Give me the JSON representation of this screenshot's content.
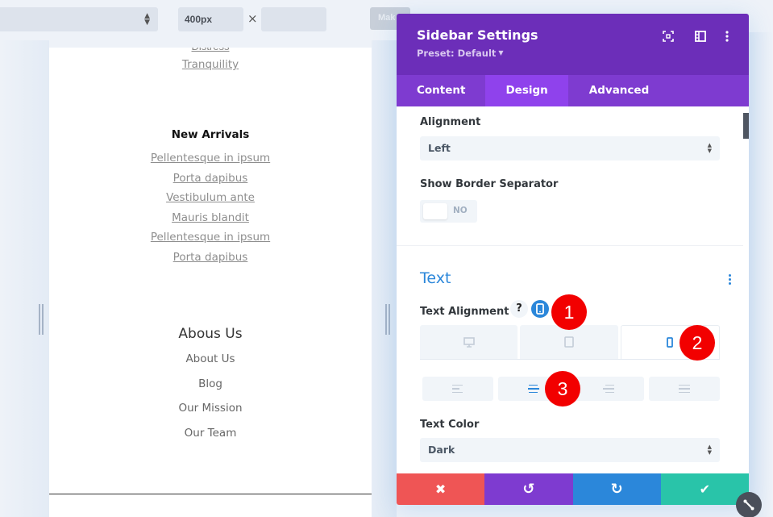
{
  "toolbar": {
    "device_select_value": "",
    "width_value": "400px",
    "times_symbol": "×",
    "height_value": "",
    "make_button_label": "Mak"
  },
  "preview": {
    "cut_link": "Distress",
    "tranquility_link": "Tranquility",
    "new_arrivals": {
      "title": "New Arrivals",
      "links": [
        "Pellentesque in ipsum",
        "Porta dapibus",
        "Vestibulum ante",
        "Mauris blandit",
        "Pellentesque in ipsum",
        "Porta dapibus"
      ]
    },
    "about": {
      "title": "Abous Us",
      "items": [
        "About Us",
        "Blog",
        "Our Mission",
        "Our Team"
      ]
    }
  },
  "panel": {
    "title": "Sidebar Settings",
    "preset": "Preset: Default",
    "icons": [
      "focus-icon",
      "split-view-icon",
      "more-options-icon"
    ],
    "tabs": [
      {
        "label": "Content",
        "active": false
      },
      {
        "label": "Design",
        "active": true
      },
      {
        "label": "Advanced",
        "active": false
      }
    ],
    "alignment": {
      "label": "Alignment",
      "value": "Left"
    },
    "border_separator": {
      "label": "Show Border Separator",
      "value": "NO"
    },
    "text_section": {
      "title": "Text",
      "text_alignment_label": "Text Alignment",
      "help": "?",
      "device_tabs": [
        "desktop",
        "tablet",
        "phone"
      ],
      "active_device": "phone",
      "align_options": [
        "left",
        "center",
        "right",
        "justify"
      ],
      "active_align": "center",
      "text_color": {
        "label": "Text Color",
        "value": "Dark"
      }
    },
    "footer": {
      "cancel": "✖",
      "undo": "↺",
      "redo": "↻",
      "save": "✔"
    }
  },
  "annotations": [
    "1",
    "2",
    "3"
  ],
  "colors": {
    "header": "#6c2eb9",
    "tabs": "#7e3bd0",
    "active_tab": "#8f42ec",
    "accent_blue": "#2b87da",
    "cancel": "#ef5555",
    "undo": "#7e3bd0",
    "redo": "#2b87da",
    "save": "#29c4a9",
    "badge": "#f20000"
  }
}
